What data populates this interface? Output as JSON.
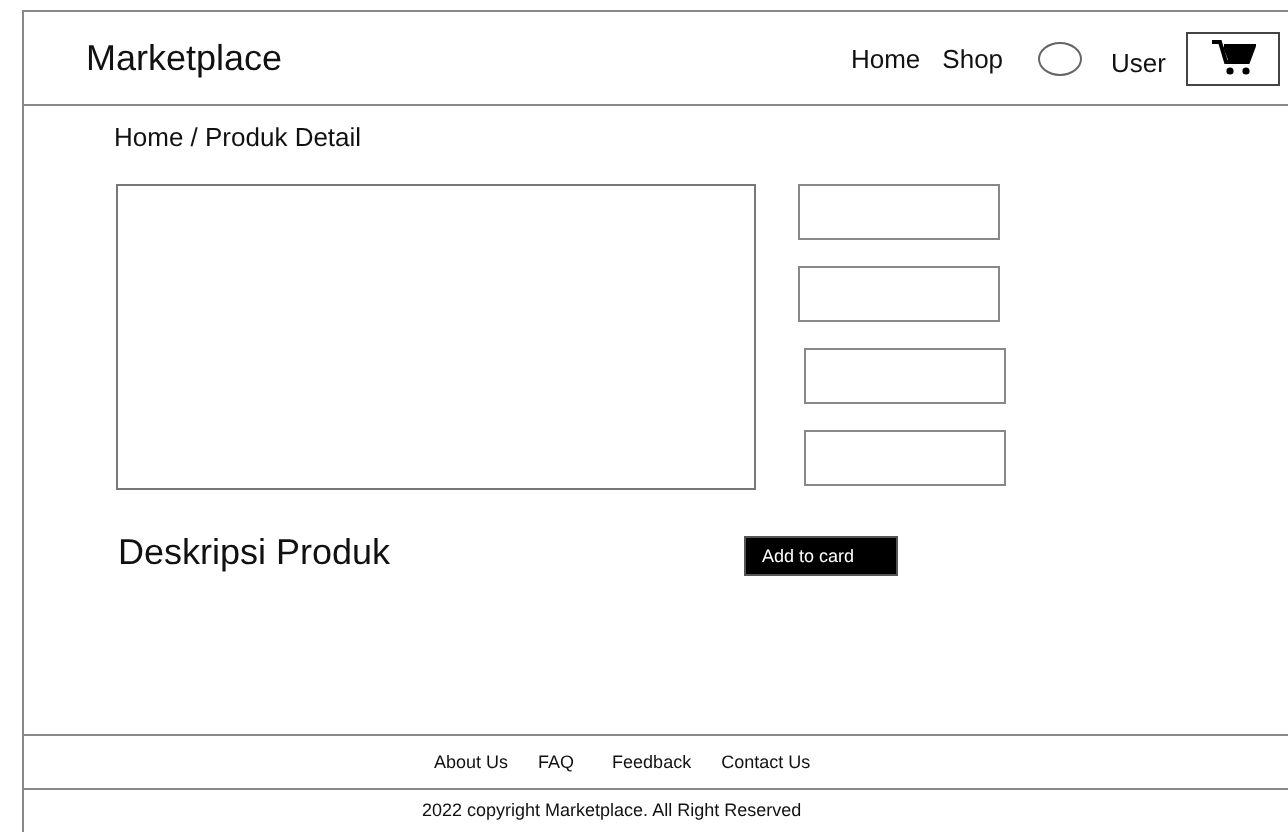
{
  "header": {
    "brand": "Marketplace",
    "nav": [
      "Home",
      "Shop"
    ],
    "user": "User"
  },
  "breadcrumb": "Home / Produk Detail",
  "product": {
    "description_title": "Deskripsi Produk",
    "button": "Add to card"
  },
  "footer": {
    "links": [
      "About Us",
      "FAQ",
      "Feedback",
      "Contact Us"
    ],
    "copyright": "2022 copyright Marketplace. All Right Reserved"
  }
}
